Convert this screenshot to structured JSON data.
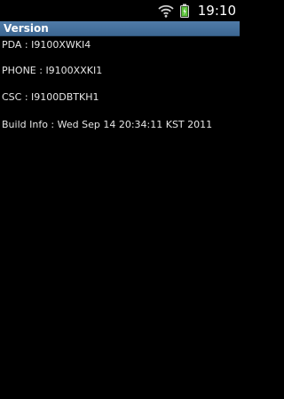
{
  "status_bar": {
    "time": "19:10",
    "icons": [
      "wifi-icon",
      "battery-icon"
    ],
    "battery_color": "#5cc43a"
  },
  "title_bar": {
    "title": "Version",
    "color": "#416c97"
  },
  "info": {
    "pda": "PDA : I9100XWKI4",
    "phone": "PHONE : I9100XXKI1",
    "csc": "CSC : I9100DBTKH1",
    "build": "Build Info : Wed Sep 14 20:34:11 KST 2011"
  }
}
